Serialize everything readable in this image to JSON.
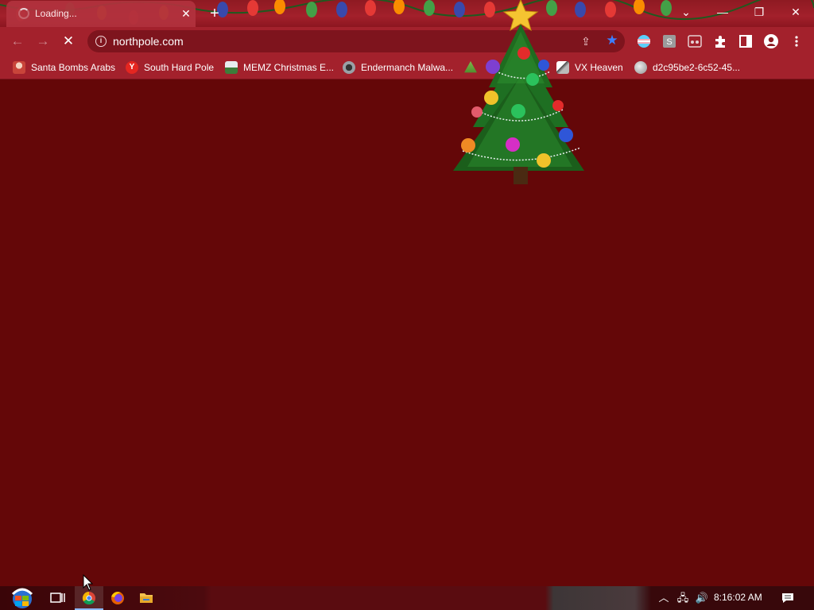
{
  "browser": {
    "tab": {
      "title": "Loading..."
    },
    "window_controls": {
      "tab_search": "⌄",
      "minimize": "—",
      "restore": "❐",
      "close": "✕"
    }
  },
  "toolbar": {
    "back_icon": "←",
    "forward_icon": "→",
    "stop_icon": "✕",
    "url": "northpole.com"
  },
  "bookmarks": [
    {
      "label": "Santa Bombs Arabs",
      "icon": "santa-icon",
      "color": "#c8443a"
    },
    {
      "label": "South Hard Pole",
      "icon": "yandex-icon",
      "color": "#e52620"
    },
    {
      "label": "MEMZ Christmas E...",
      "icon": "memz-icon",
      "color": "#cfd4d8"
    },
    {
      "label": "Endermanch Malwa...",
      "icon": "enderman-icon",
      "color": "#9aa0a6"
    },
    {
      "label": "",
      "icon": "christmas-tree-icon",
      "color": "#4c8a2c"
    },
    {
      "label": "VX Heaven",
      "icon": "vx-heaven-icon",
      "color": "#e8e8ff"
    },
    {
      "label": "d2c95be2-6c52-45...",
      "icon": "globe-icon",
      "color": "#d8d8d8"
    }
  ],
  "taskbar": {
    "apps": [
      "start-button",
      "task-view",
      "chrome",
      "firefox",
      "file-explorer"
    ],
    "clock": "8:16:02 AM"
  },
  "colors": {
    "page_background": "#640708",
    "toolbar": "#a3212c",
    "accent_star": "#3d7fff"
  }
}
